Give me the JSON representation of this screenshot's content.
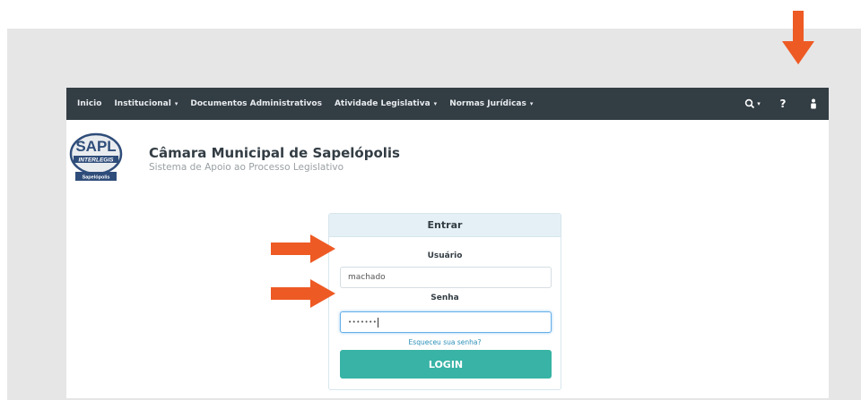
{
  "navbar": {
    "items": [
      {
        "label": "Inicio",
        "has_caret": false
      },
      {
        "label": "Institucional",
        "has_caret": true
      },
      {
        "label": "Documentos Administrativos",
        "has_caret": false
      },
      {
        "label": "Atividade Legislativa",
        "has_caret": true
      },
      {
        "label": "Normas Jurídicas",
        "has_caret": true
      }
    ],
    "search_icon": "search-icon",
    "help_label": "?",
    "user_icon": "user-icon",
    "caret": "▾"
  },
  "brand": {
    "logo_text": "SAPL",
    "logo_band": "INTERLEGIS",
    "logo_city": "Sapelópolis",
    "title": "Câmara Municipal de Sapelópolis",
    "subtitle": "Sistema de Apoio ao Processo Legislativo"
  },
  "login": {
    "header": "Entrar",
    "username_label": "Usuário",
    "username_value": "machado",
    "password_label": "Senha",
    "password_value": "•••••••",
    "forgot_link": "Esqueceu sua senha?",
    "button_label": "LOGIN"
  },
  "annotations": {
    "color": "#ee5a24"
  },
  "colors": {
    "navbar": "#333d44",
    "login_button": "#38b3a5",
    "card_header": "#e4f0f5",
    "link": "#2a8fb8"
  }
}
